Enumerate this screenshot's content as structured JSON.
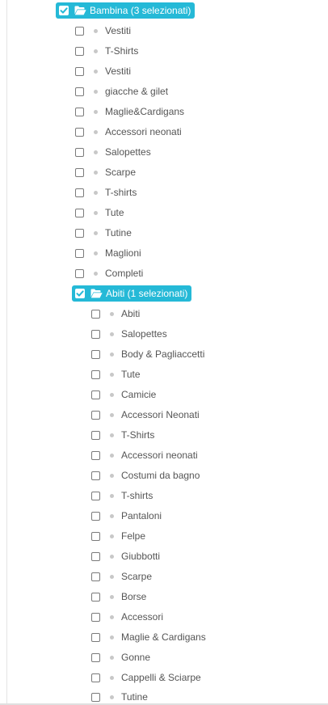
{
  "tree": {
    "group1": {
      "label": "Bambina (3 selezionati)",
      "checked": true,
      "items": [
        {
          "label": "Vestiti"
        },
        {
          "label": "T-Shirts"
        },
        {
          "label": "Vestiti"
        },
        {
          "label": "giacche & gilet"
        },
        {
          "label": "Maglie&Cardigans"
        },
        {
          "label": "Accessori neonati"
        },
        {
          "label": "Salopettes"
        },
        {
          "label": "Scarpe"
        },
        {
          "label": "T-shirts"
        },
        {
          "label": "Tute"
        },
        {
          "label": "Tutine"
        },
        {
          "label": "Maglioni"
        },
        {
          "label": "Completi"
        }
      ]
    },
    "group2": {
      "label": "Abiti (1 selezionati)",
      "checked": true,
      "items": [
        {
          "label": "Abiti"
        },
        {
          "label": "Salopettes"
        },
        {
          "label": "Body & Pagliaccetti"
        },
        {
          "label": "Tute"
        },
        {
          "label": "Camicie"
        },
        {
          "label": "Accessori Neonati"
        },
        {
          "label": "T-Shirts"
        },
        {
          "label": "Accessori neonati"
        },
        {
          "label": "Costumi da bagno"
        },
        {
          "label": "T-shirts"
        },
        {
          "label": "Pantaloni"
        },
        {
          "label": "Felpe"
        },
        {
          "label": "Giubbotti"
        },
        {
          "label": "Scarpe"
        },
        {
          "label": "Borse"
        },
        {
          "label": "Accessori"
        },
        {
          "label": "Maglie & Cardigans"
        },
        {
          "label": "Gonne"
        },
        {
          "label": "Cappelli & Sciarpe"
        },
        {
          "label": "Tutine"
        }
      ]
    },
    "colors": {
      "accent": "#25b9d7",
      "text": "#555555",
      "bullet": "#c8c8c8",
      "checkbox_border": "#7a7a7a"
    },
    "icons": {
      "folder": "folder-open-icon",
      "check": "check-icon",
      "bullet": "bullet-icon"
    }
  }
}
